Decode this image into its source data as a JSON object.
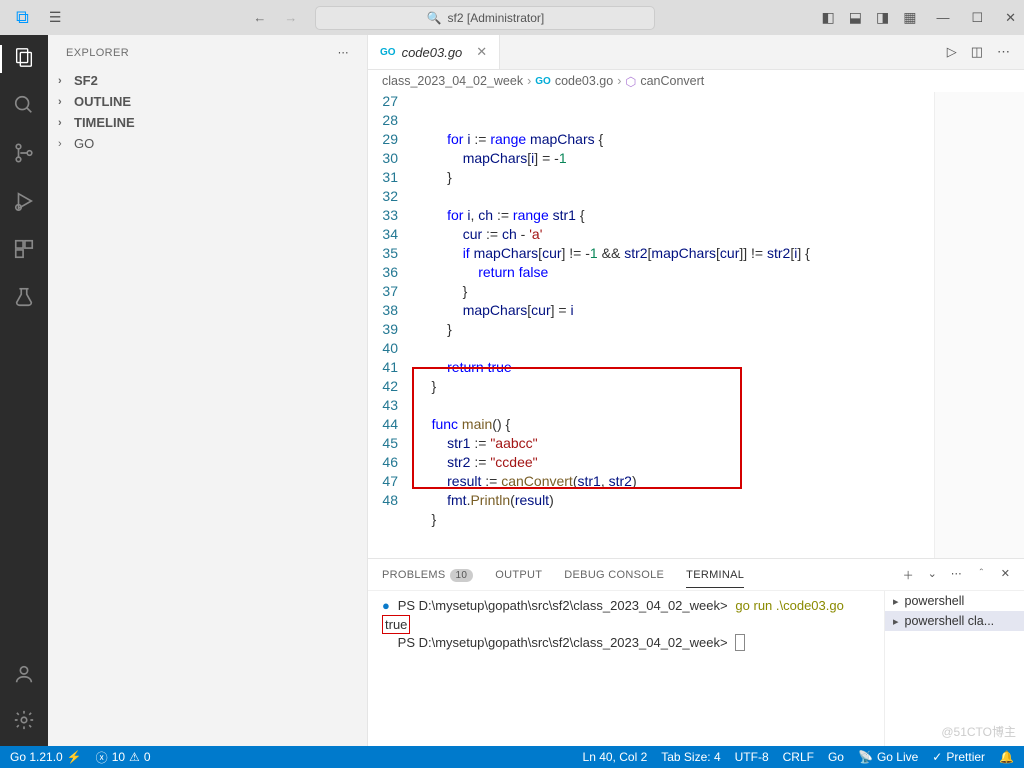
{
  "title": {
    "app": "sf2 [Administrator]"
  },
  "explorer": {
    "label": "EXPLORER",
    "items": [
      {
        "label": "SF2",
        "bold": true
      },
      {
        "label": "OUTLINE",
        "bold": true
      },
      {
        "label": "TIMELINE",
        "bold": true
      },
      {
        "label": "GO",
        "bold": false
      }
    ]
  },
  "tab": {
    "file": "code03.go"
  },
  "breadcrumb": {
    "folder": "class_2023_04_02_week",
    "file": "code03.go",
    "func": "canConvert"
  },
  "code": {
    "start": 27,
    "lines": [
      "        for i := range mapChars {",
      "            mapChars[i] = -1",
      "        }",
      "",
      "        for i, ch := range str1 {",
      "            cur := ch - 'a'",
      "            if mapChars[cur] != -1 && str2[mapChars[cur]] != str2[i] {",
      "                return false",
      "            }",
      "            mapChars[cur] = i",
      "        }",
      "",
      "        return true",
      "    }",
      "",
      "    func main() {",
      "        str1 := \"aabcc\"",
      "        str2 := \"ccdee\"",
      "        result := canConvert(str1, str2)",
      "        fmt.Println(result)",
      "    }",
      ""
    ]
  },
  "panel": {
    "tabs": {
      "problems": "PROBLEMS",
      "problems_badge": "10",
      "output": "OUTPUT",
      "debug": "DEBUG CONSOLE",
      "terminal": "TERMINAL"
    }
  },
  "terminal": {
    "line1_prompt": "PS D:\\mysetup\\gopath\\src\\sf2\\class_2023_04_02_week>",
    "line1_cmd": "go run .\\code03.go",
    "line2": "true",
    "line3_prompt": "PS D:\\mysetup\\gopath\\src\\sf2\\class_2023_04_02_week>",
    "list": [
      {
        "label": "powershell"
      },
      {
        "label": "powershell cla..."
      }
    ]
  },
  "status": {
    "go": "Go 1.21.0",
    "errors": "10",
    "warnings": "0",
    "pos": "Ln 40, Col 2",
    "tab": "Tab Size: 4",
    "enc": "UTF-8",
    "eol": "CRLF",
    "lang": "Go",
    "live": "Go Live",
    "prettier": "Prettier"
  },
  "watermark": "@51CTO博主"
}
